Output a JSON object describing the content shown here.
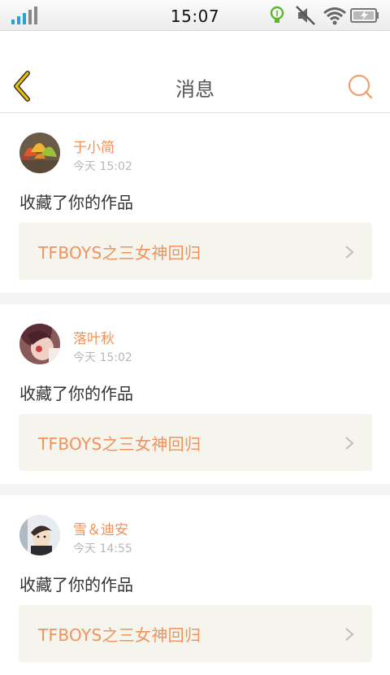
{
  "status_bar": {
    "time": "15:07",
    "icons": [
      "signal-icon",
      "bulb-icon",
      "mute-icon",
      "wifi-icon",
      "battery-icon"
    ]
  },
  "header": {
    "title": "消息",
    "back_icon": "back-chevron-icon",
    "search_icon": "search-icon"
  },
  "colors": {
    "accent": "#f0925a",
    "back_icon": "#f2c200",
    "card_bg": "#f5f5ee",
    "separator": "#f4f4f4"
  },
  "messages": [
    {
      "user": "于小简",
      "time": "今天 15:02",
      "action": "收藏了你的作品",
      "work_title": "TFBOYS之三女神回归",
      "avatar": "leaves-avatar"
    },
    {
      "user": "落叶秋",
      "time": "今天 15:02",
      "action": "收藏了你的作品",
      "work_title": "TFBOYS之三女神回归",
      "avatar": "girl-avatar"
    },
    {
      "user": "雪＆迪安",
      "time": "今天 14:55",
      "action": "收藏了你的作品",
      "work_title": "TFBOYS之三女神回归",
      "avatar": "boy-avatar"
    }
  ]
}
